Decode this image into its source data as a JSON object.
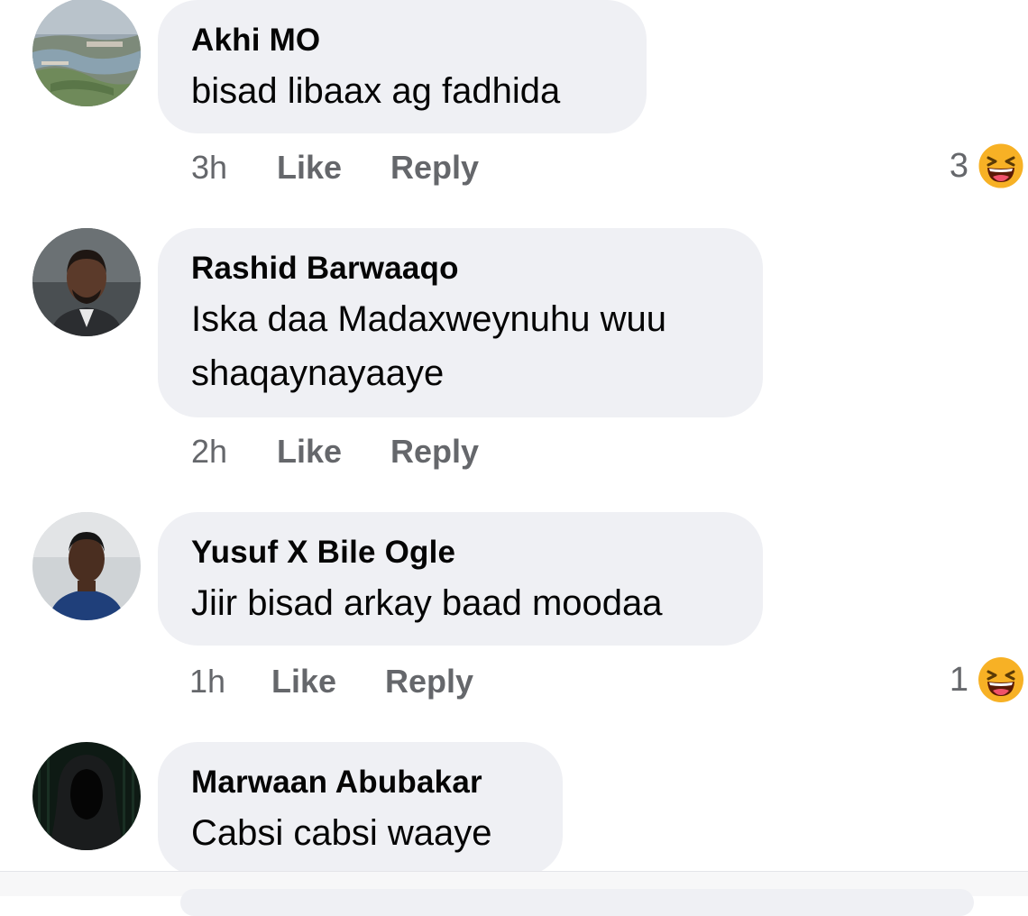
{
  "comments": [
    {
      "author": "Akhi MO",
      "lines": [
        "bisad libaax ag fadhida"
      ],
      "time": "3h",
      "like_label": "Like",
      "reply_label": "Reply",
      "reaction_count": "3",
      "reaction_icon": "laughing-face-icon",
      "avatar_icon": "landscape-avatar"
    },
    {
      "author": "Rashid Barwaaqo",
      "lines": [
        "Iska daa Madaxweynuhu wuu",
        "shaqaynayaaye"
      ],
      "time": "2h",
      "like_label": "Like",
      "reply_label": "Reply",
      "avatar_icon": "person-avatar"
    },
    {
      "author": "Yusuf X Bile Ogle",
      "lines": [
        "Jiir bisad arkay baad moodaa"
      ],
      "time": "1h",
      "like_label": "Like",
      "reply_label": "Reply",
      "reaction_count": "1",
      "reaction_icon": "laughing-face-icon",
      "avatar_icon": "person-avatar"
    },
    {
      "author": "Marwaan Abubakar",
      "lines": [
        "Cabsi cabsi waaye"
      ],
      "avatar_icon": "hooded-figure-avatar"
    }
  ],
  "colors": {
    "bubble": "#eff0f4",
    "secondary_text": "#65676b",
    "primary_text": "#050505",
    "reaction_yellow": "#f7b125"
  }
}
